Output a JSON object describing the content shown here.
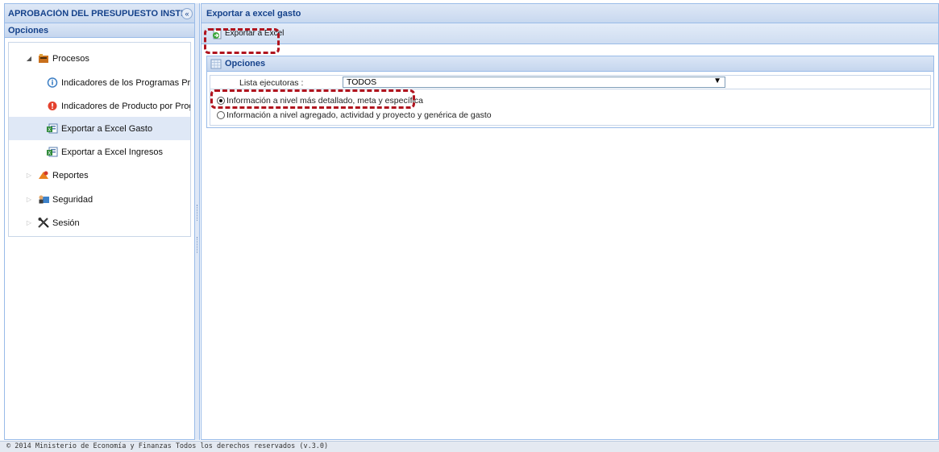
{
  "left_panel": {
    "title": "APROBACIÓN DEL PRESUPUESTO INSTITUCIONAL",
    "options_header": "Opciones",
    "tree": [
      {
        "label": "Procesos",
        "expanded": true,
        "icon": "folder-books-icon",
        "level": 0
      },
      {
        "label": "Indicadores de los Programas Presupuestales",
        "icon": "info-circle-icon",
        "level": 1
      },
      {
        "label": "Indicadores de Producto por Programa",
        "icon": "info-circle-red-icon",
        "level": 1
      },
      {
        "label": "Exportar a Excel Gasto",
        "icon": "excel-export-icon",
        "level": 1,
        "selected": true
      },
      {
        "label": "Exportar a Excel Ingresos",
        "icon": "excel-export-icon",
        "level": 1
      },
      {
        "label": "Reportes",
        "expanded": false,
        "icon": "reports-icon",
        "level": 0
      },
      {
        "label": "Seguridad",
        "expanded": false,
        "icon": "security-users-icon",
        "level": 0
      },
      {
        "label": "Sesión",
        "expanded": false,
        "icon": "tools-icon",
        "level": 0
      }
    ]
  },
  "right_panel": {
    "title": "Exportar a excel gasto",
    "toolbar": {
      "export_label": "Exportar a Excel"
    },
    "options": {
      "header": "Opciones",
      "lista_label": "Lista ejecutoras :",
      "lista_value": "TODOS",
      "radio_detailed": "Información a nivel más detallado, meta y específica",
      "radio_aggregated": "Información a nivel agregado, actividad y proyecto y genérica de gasto",
      "selected_option": "detailed"
    }
  },
  "footer": {
    "text": "© 2014 Ministerio de Economía y Finanzas Todos los derechos reservados (v.3.0)"
  },
  "colors": {
    "highlight": "#b0141e",
    "header_text": "#15428b",
    "panel_border": "#99bbe8"
  }
}
